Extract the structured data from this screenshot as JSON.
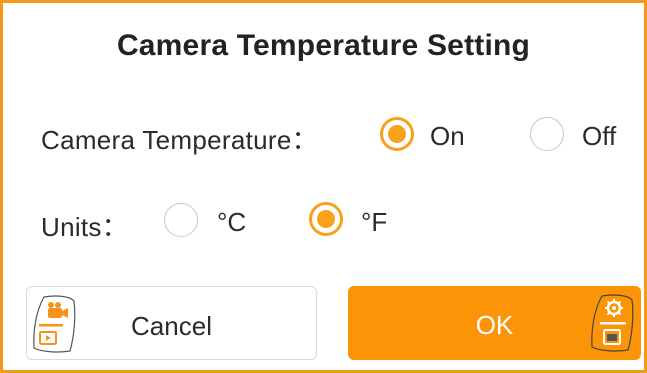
{
  "dialog": {
    "title": "Camera Temperature Setting",
    "camera_temperature": {
      "label": "Camera Temperature：",
      "options": [
        {
          "label": "On",
          "selected": true
        },
        {
          "label": "Off",
          "selected": false
        }
      ]
    },
    "units": {
      "label": "Units：",
      "options": [
        {
          "label": "°C",
          "selected": false
        },
        {
          "label": "°F",
          "selected": true
        }
      ]
    },
    "buttons": {
      "cancel_label": "Cancel",
      "ok_label": "OK"
    }
  },
  "icons": {
    "cancel_badge": "camera-playback-icon",
    "ok_badge": "gear-settings-icon"
  },
  "colors": {
    "accent": "#f7a21a",
    "border": "#f39a1a",
    "ok_button": "#fb9406"
  }
}
